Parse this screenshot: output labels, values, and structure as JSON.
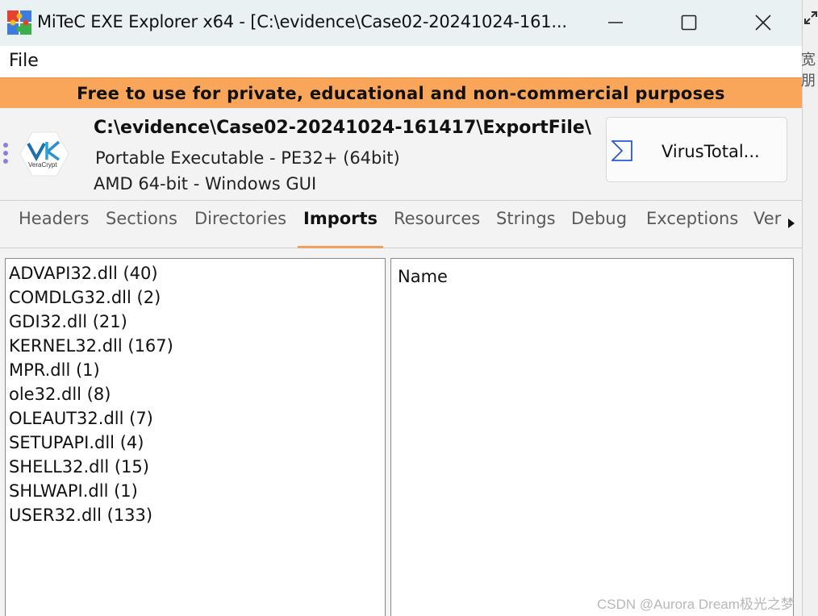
{
  "window": {
    "title": "MiTeC EXE Explorer x64 - [C:\\evidence\\Case02-20241024-161...",
    "controls": {
      "minimize": "minimize-icon",
      "maximize": "maximize-icon",
      "close": "close-icon"
    }
  },
  "menu": {
    "items": [
      "File"
    ]
  },
  "banner": {
    "text": "Free to use for private, educational and non-commercial  purposes",
    "color": "#f9a65a"
  },
  "file_info": {
    "logo_text": "VeraCrypt",
    "path": "C:\\evidence\\Case02-20241024-161417\\ExportFile\\",
    "format": "Portable Executable - PE32+ (64bit)",
    "arch": "AMD 64-bit - Windows GUI"
  },
  "virustotal": {
    "label": "VirusTotal..."
  },
  "tabs": {
    "items": [
      "Headers",
      "Sections",
      "Directories",
      "Imports",
      "Resources",
      "Strings",
      "Debug",
      "Exceptions",
      "Ver"
    ],
    "active": "Imports"
  },
  "imports": {
    "dlls": [
      "ADVAPI32.dll (40)",
      "COMDLG32.dll (2)",
      "GDI32.dll (21)",
      "KERNEL32.dll (167)",
      "MPR.dll (1)",
      "ole32.dll (8)",
      "OLEAUT32.dll (7)",
      "SETUPAPI.dll (4)",
      "SHELL32.dll (15)",
      "SHLWAPI.dll (1)",
      "USER32.dll (133)"
    ],
    "function_column_header": "Name"
  },
  "background": {
    "partial_text": "宽朋"
  },
  "watermark": "CSDN @Aurora Dream极光之梦"
}
